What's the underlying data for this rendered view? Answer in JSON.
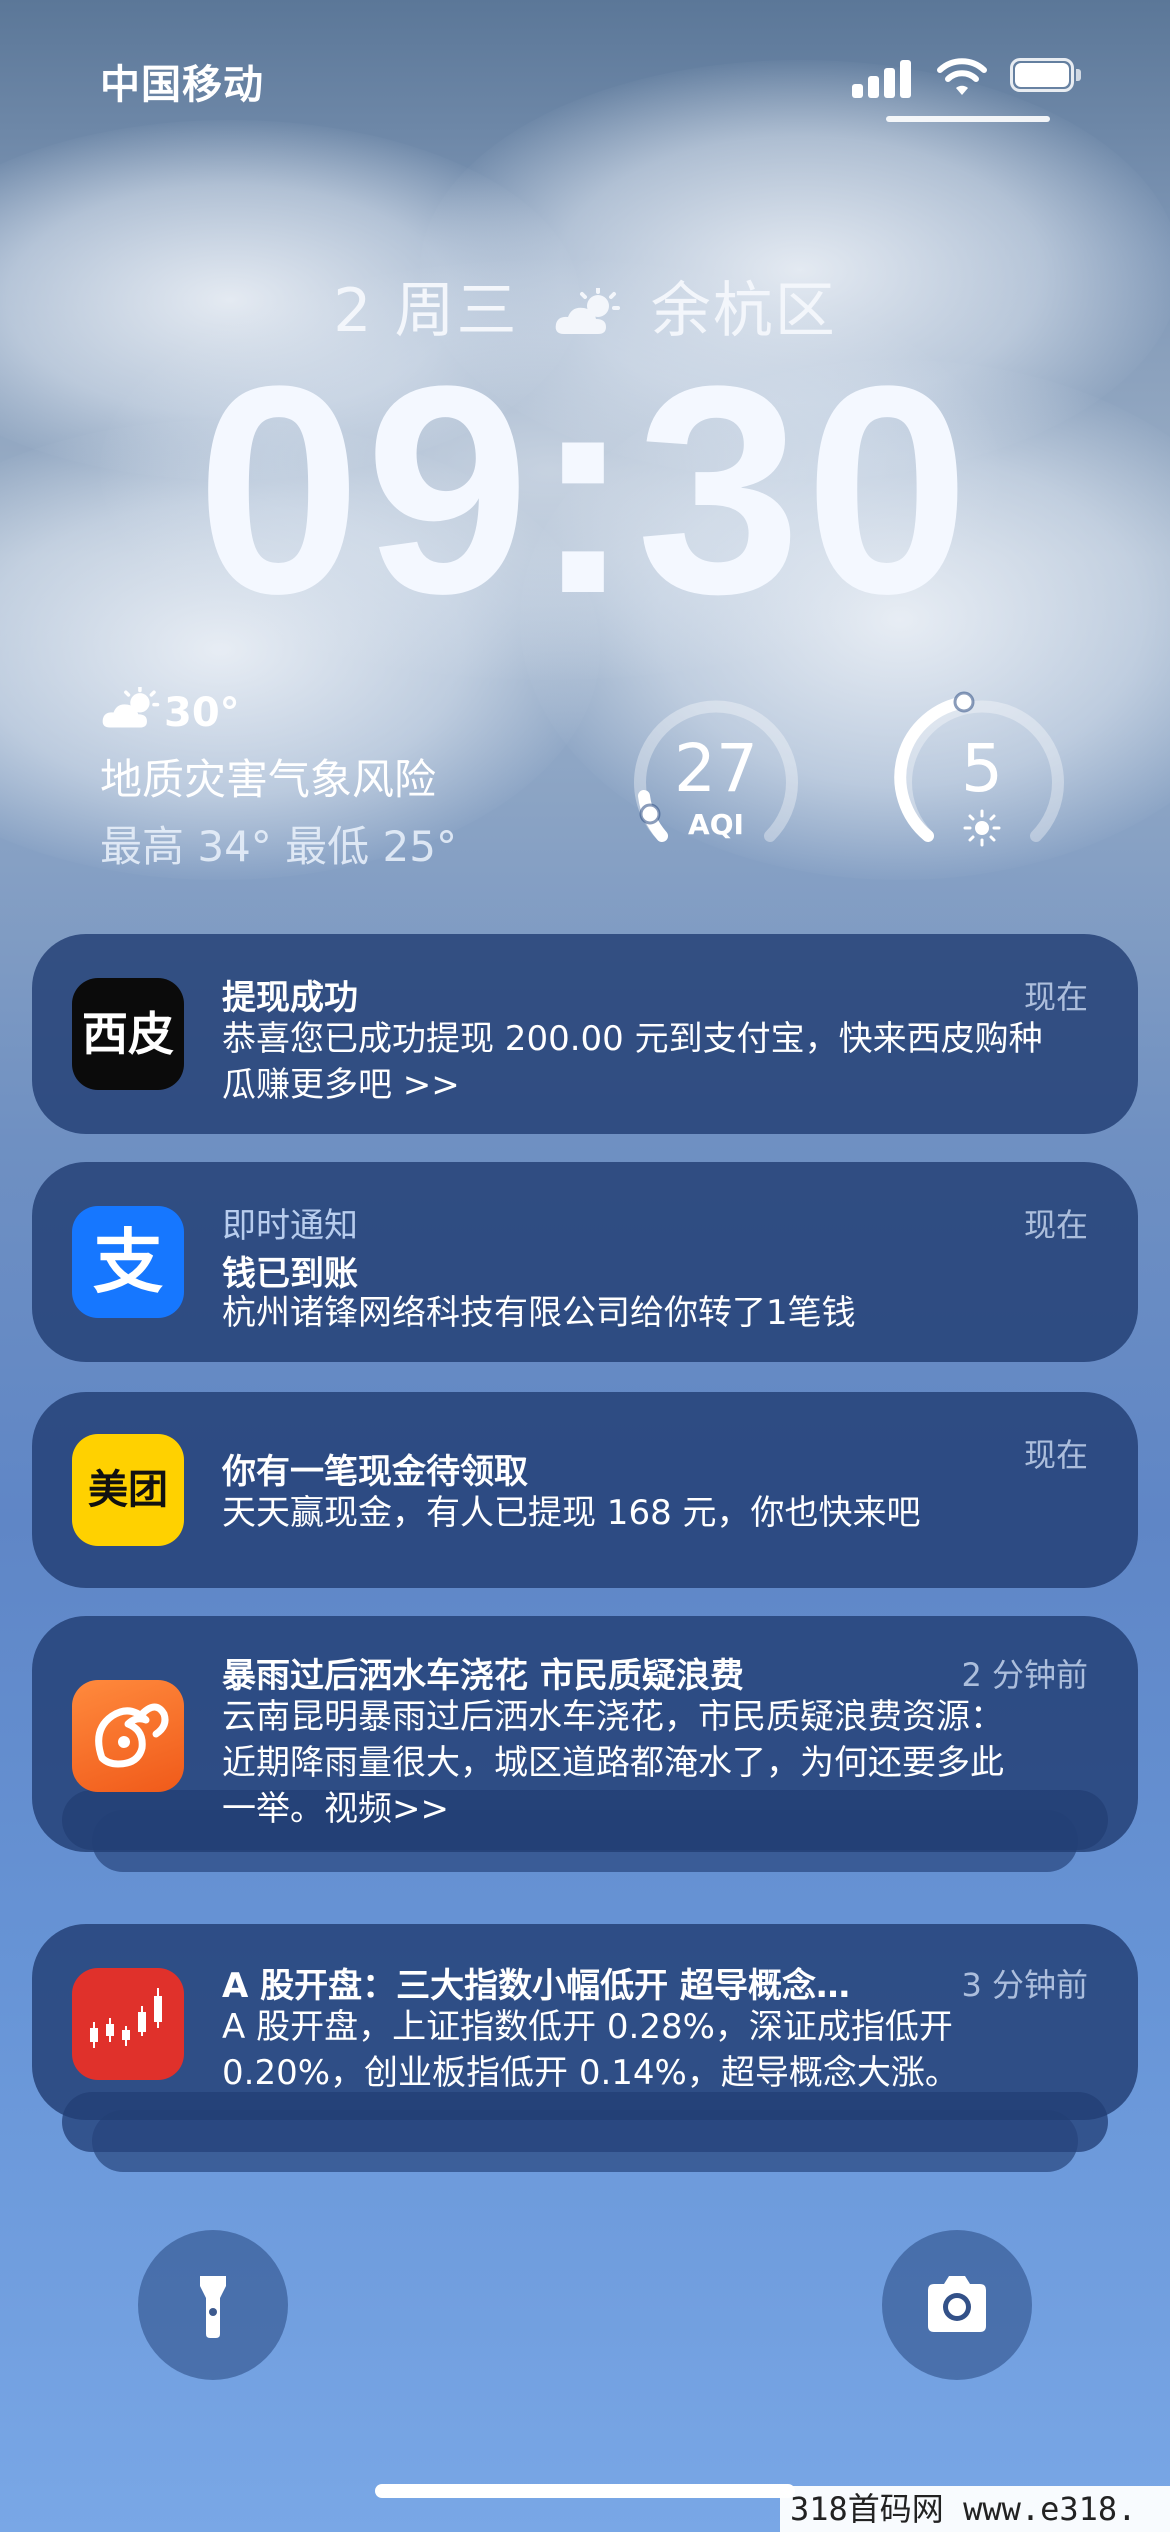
{
  "status_bar": {
    "carrier": "中国移动",
    "signal_icon": "cellular-signal-icon",
    "wifi_icon": "wifi-icon",
    "battery_icon": "battery-icon"
  },
  "lock_screen": {
    "date": "2 周三",
    "weather_icon": "partly-sunny-icon",
    "location": "余杭区",
    "time": "09:30"
  },
  "weather_widget": {
    "icon": "partly-sunny-icon",
    "temperature": "30°",
    "alert": "地质灾害气象风险",
    "high_low": "最高 34° 最低 25°"
  },
  "aqi_widget": {
    "value": "27",
    "label": "AQI",
    "level": 0.27
  },
  "uv_widget": {
    "value": "5",
    "icon": "sun-icon",
    "level": 0.45
  },
  "notifications": [
    {
      "app": "西皮",
      "icon_text": "西皮",
      "title": "提现成功",
      "time": "现在",
      "body_line1": "恭喜您已成功提现 200.00 元到支付宝，快来西皮购种",
      "body_line2": "瓜赚更多吧 >>"
    },
    {
      "app": "支付宝",
      "icon_text": "支",
      "category": "即时通知",
      "title": "钱已到账",
      "time": "现在",
      "body": "杭州诸锋网络科技有限公司给你转了1笔钱"
    },
    {
      "app": "美团",
      "icon_text": "美团",
      "title": "你有一笔现金待领取",
      "time": "现在",
      "body": "天天赢现金，有人已提现 168 元，你也快来吧"
    },
    {
      "app": "UC浏览器",
      "icon_text": "squirrel-logo-icon",
      "title": "暴雨过后洒水车浇花 市民质疑浪费",
      "time": "2 分钟前",
      "body_line1": "云南昆明暴雨过后洒水车浇花，市民质疑浪费资源：",
      "body_line2": "近期降雨量很大，城区道路都淹水了，为何还要多此",
      "body_line3": "一举。视频>>"
    },
    {
      "app": "股票",
      "icon_text": "candlestick-chart-icon",
      "title": "A 股开盘：三大指数小幅低开 超导概念…",
      "time": "3 分钟前",
      "body_line1": "A 股开盘，上证指数低开 0.28%，深证成指低开",
      "body_line2": "0.20%，创业板指低开 0.14%，超导概念大涨。"
    }
  ],
  "bottom_controls": {
    "flashlight_icon": "flashlight-icon",
    "camera_icon": "camera-icon"
  },
  "watermark": "318首码网  www.e318."
}
